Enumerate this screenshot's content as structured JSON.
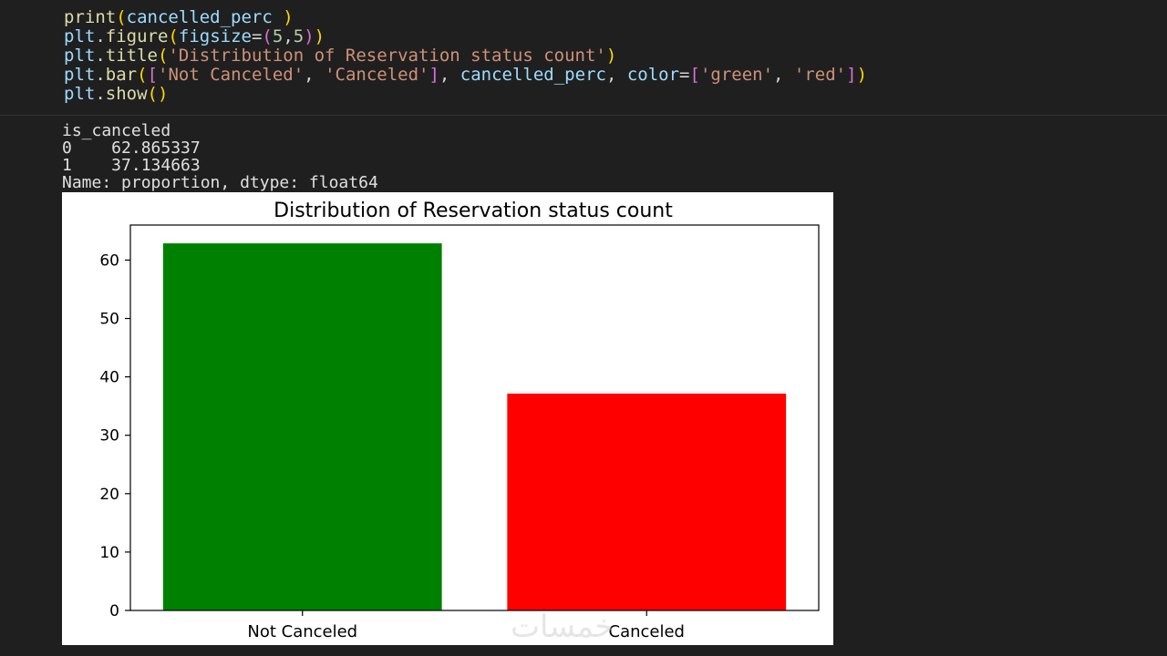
{
  "code": {
    "lines": [
      "print(cancelled_perc )",
      "plt.figure(figsize=(5,5))",
      "plt.title('Distribution of Reservation status count')",
      "plt.bar(['Not Canceled', 'Canceled'], cancelled_perc, color=['green', 'red'])",
      "plt.show()"
    ]
  },
  "output": {
    "lines": [
      "is_canceled",
      "0    62.865337",
      "1    37.134663",
      "Name: proportion, dtype: float64"
    ]
  },
  "watermark": "خمسات",
  "chart_data": {
    "type": "bar",
    "title": "Distribution of Reservation status count",
    "categories": [
      "Not Canceled",
      "Canceled"
    ],
    "values": [
      62.865337,
      37.134663
    ],
    "colors": [
      "#008000",
      "#ff0000"
    ],
    "xlabel": "",
    "ylabel": "",
    "ylim": [
      0,
      66
    ],
    "yticks": [
      0,
      10,
      20,
      30,
      40,
      50,
      60
    ],
    "yticklabels": [
      "0",
      "10",
      "20",
      "30",
      "40",
      "50",
      "60"
    ],
    "grid": false
  }
}
